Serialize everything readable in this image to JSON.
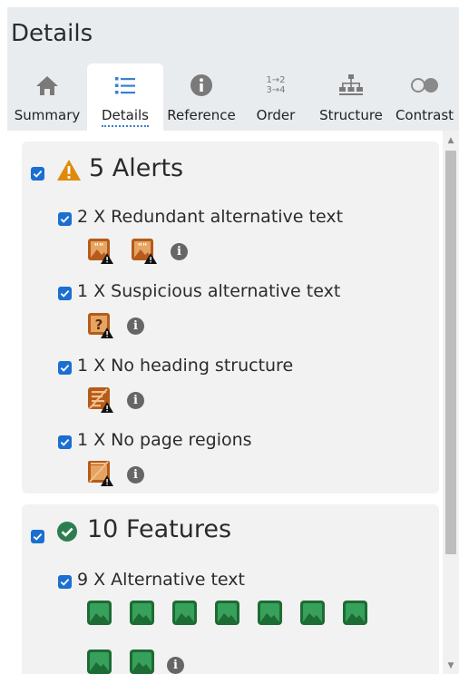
{
  "panel": {
    "title": "Details"
  },
  "tabs": [
    {
      "label": "Summary",
      "icon": "home-icon"
    },
    {
      "label": "Details",
      "icon": "list-icon",
      "active": true
    },
    {
      "label": "Reference",
      "icon": "info-icon"
    },
    {
      "label": "Order",
      "icon": "order-icon",
      "glyph_top": "1→2",
      "glyph_bottom": "3→4"
    },
    {
      "label": "Structure",
      "icon": "structure-icon"
    },
    {
      "label": "Contrast",
      "icon": "contrast-icon"
    }
  ],
  "alerts": {
    "heading": "5 Alerts",
    "checked": true,
    "icon": "warning-icon",
    "color": "#e08a0b",
    "items": [
      {
        "label": "2 X Redundant alternative text",
        "checked": true,
        "icon": "redundant-alt-icon",
        "count": 2,
        "glyph": "\"\""
      },
      {
        "label": "1 X Suspicious alternative text",
        "checked": true,
        "icon": "suspicious-alt-icon",
        "count": 1,
        "glyph": "?"
      },
      {
        "label": "1 X No heading structure",
        "checked": true,
        "icon": "no-heading-icon",
        "count": 1
      },
      {
        "label": "1 X No page regions",
        "checked": true,
        "icon": "no-regions-icon",
        "count": 1
      }
    ]
  },
  "features": {
    "heading": "10 Features",
    "checked": true,
    "icon": "check-circle-icon",
    "color": "#2e7d4f",
    "items": [
      {
        "label": "9 X Alternative text",
        "checked": true,
        "icon": "alt-text-icon",
        "count": 9
      }
    ]
  },
  "info_glyph": "i"
}
